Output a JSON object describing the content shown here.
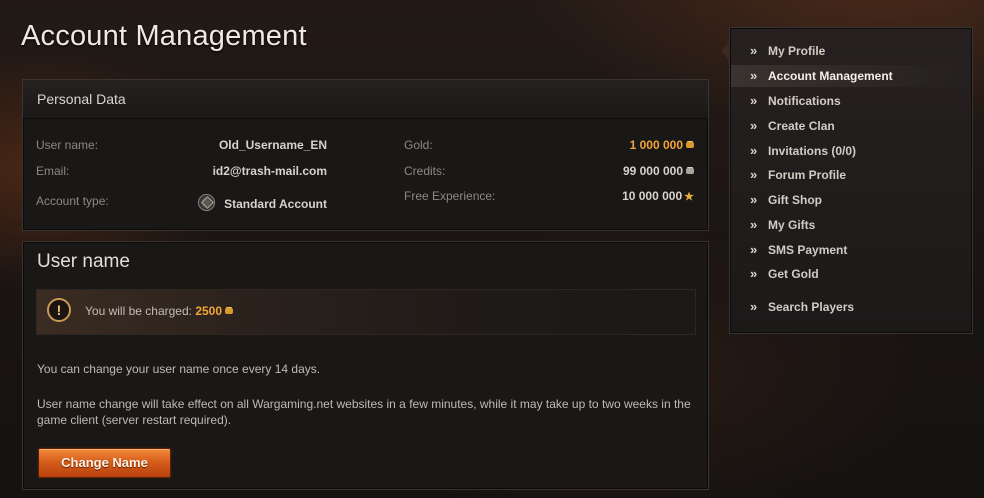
{
  "page": {
    "title": "Account Management"
  },
  "personal_data": {
    "title": "Personal Data",
    "username_label": "User name:",
    "username_value": "Old_Username_EN",
    "email_label": "Email:",
    "email_value": "id2@trash-mail.com",
    "account_type_label": "Account type:",
    "account_type_value": "Standard Account",
    "gold_label": "Gold:",
    "gold_value": "1 000 000",
    "credits_label": "Credits:",
    "credits_value": "99 000 000",
    "free_exp_label": "Free Experience:",
    "free_exp_value": "10 000 000",
    "colors": {
      "gold": "#f0a53a"
    }
  },
  "username_panel": {
    "title": "User name",
    "charge_label": "You will be charged:",
    "charge_amount": "2500",
    "info_1": "You can change your user name once every 14 days.",
    "info_2": "User name change will take effect on all Wargaming.net websites in a few minutes, while it may take up to two weeks in the game client (server restart required).",
    "button_label": "Change Name",
    "colors": {
      "button": "#d35a1a"
    }
  },
  "sidebar": {
    "items": [
      {
        "label": "My Profile",
        "active": false
      },
      {
        "label": "Account Management",
        "active": true
      },
      {
        "label": "Notifications",
        "active": false
      },
      {
        "label": "Create Clan",
        "active": false
      },
      {
        "label": "Invitations (0/0)",
        "active": false
      },
      {
        "label": "Forum Profile",
        "active": false
      },
      {
        "label": "Gift Shop",
        "active": false
      },
      {
        "label": "My Gifts",
        "active": false
      },
      {
        "label": "SMS Payment",
        "active": false
      },
      {
        "label": "Get Gold",
        "active": false
      },
      {
        "label": "Search Players",
        "active": false
      }
    ],
    "chevron": "»"
  }
}
